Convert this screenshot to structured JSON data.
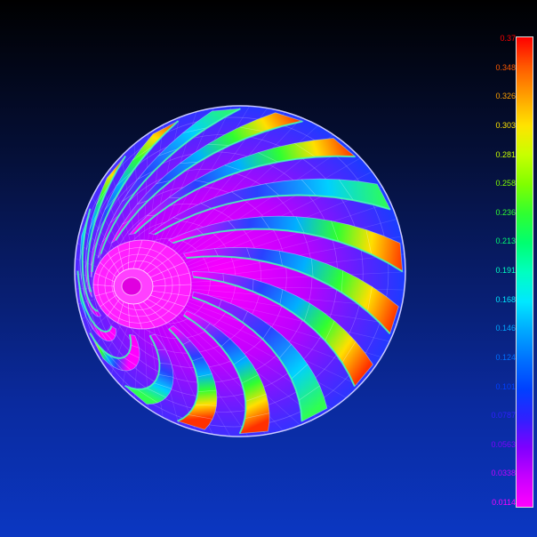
{
  "legend": {
    "values": [
      "0.37",
      "0.348",
      "0.326",
      "0.303",
      "0.281",
      "0.258",
      "0.236",
      "0.213",
      "0.191",
      "0.168",
      "0.146",
      "0.124",
      "0.101",
      "0.0787",
      "0.0563",
      "0.0338",
      "0.0114"
    ],
    "colors": [
      "#ff0000",
      "#ff5a00",
      "#ffa000",
      "#ffe400",
      "#c8ff00",
      "#80ff00",
      "#30ff30",
      "#00ff70",
      "#00ffc0",
      "#00e8ff",
      "#00a8ff",
      "#0070ff",
      "#0040ff",
      "#3020ff",
      "#8000ff",
      "#c800ff",
      "#ff00ff"
    ]
  },
  "model": {
    "blade_count": 16
  }
}
